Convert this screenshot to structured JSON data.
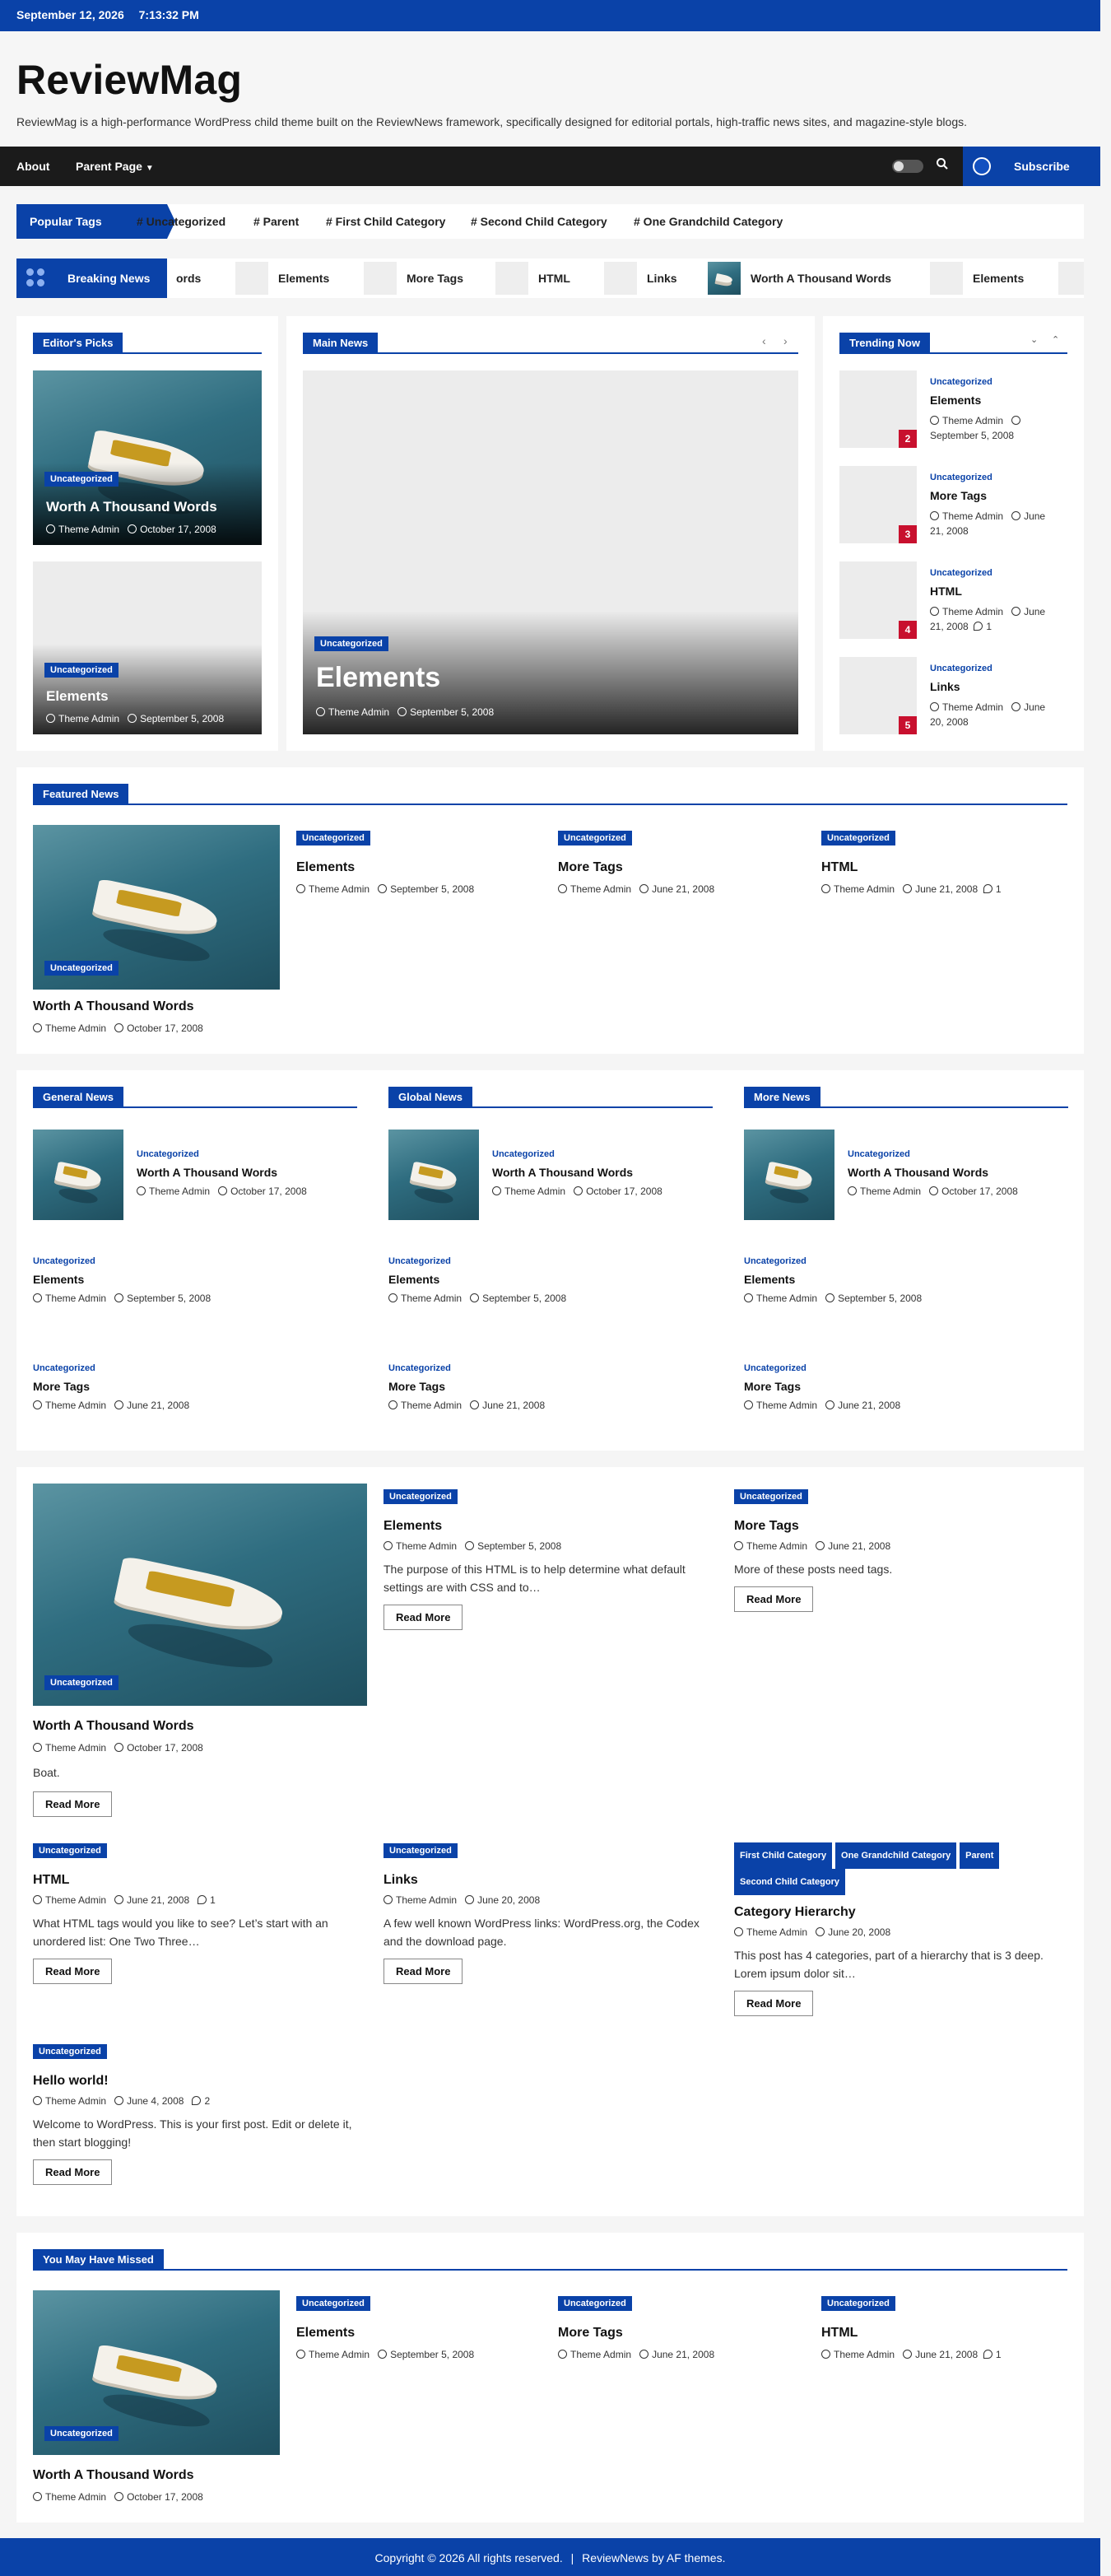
{
  "topbar": {
    "date": "September 12, 2026",
    "time": "7:13:32 PM"
  },
  "header": {
    "title": "ReviewMag",
    "tagline": "ReviewMag is a high-performance WordPress child theme built on the ReviewNews framework, specifically designed for editorial portals, high-traffic news sites, and magazine-style blogs."
  },
  "nav": {
    "about": "About",
    "parent": "Parent Page",
    "subscribe": "Subscribe"
  },
  "popular_tags": {
    "label": "Popular Tags",
    "tags": [
      "# Uncategorized",
      "# Parent",
      "# First Child Category",
      "# Second Child Category",
      "# One Grandchild Category"
    ]
  },
  "breaking": {
    "label": "Breaking News",
    "items": [
      "ords",
      "Elements",
      "More Tags",
      "HTML",
      "Links",
      "Worth A Thousand Words",
      "Elements"
    ]
  },
  "editors_picks": {
    "title": "Editor's Picks",
    "posts": [
      {
        "cat": "Uncategorized",
        "title": "Worth A Thousand Words",
        "author": "Theme Admin",
        "date": "October 17, 2008"
      },
      {
        "cat": "Uncategorized",
        "title": "Elements",
        "author": "Theme Admin",
        "date": "September 5, 2008"
      }
    ]
  },
  "main_news": {
    "title": "Main News",
    "post": {
      "cat": "Uncategorized",
      "title": "Elements",
      "author": "Theme Admin",
      "date": "September 5, 2008"
    }
  },
  "trending": {
    "title": "Trending Now",
    "posts": [
      {
        "num": "2",
        "cat": "Uncategorized",
        "title": "Elements",
        "author": "Theme Admin",
        "date": "September 5, 2008",
        "comments": ""
      },
      {
        "num": "3",
        "cat": "Uncategorized",
        "title": "More Tags",
        "author": "Theme Admin",
        "date": "June 21, 2008",
        "comments": ""
      },
      {
        "num": "4",
        "cat": "Uncategorized",
        "title": "HTML",
        "author": "Theme Admin",
        "date": "June 21, 2008",
        "comments": "1"
      },
      {
        "num": "5",
        "cat": "Uncategorized",
        "title": "Links",
        "author": "Theme Admin",
        "date": "June 20, 2008",
        "comments": ""
      }
    ]
  },
  "featured": {
    "title": "Featured News",
    "big": {
      "cat": "Uncategorized",
      "title": "Worth A Thousand Words",
      "author": "Theme Admin",
      "date": "October 17, 2008"
    },
    "posts": [
      {
        "cat": "Uncategorized",
        "title": "Elements",
        "author": "Theme Admin",
        "date": "September 5, 2008",
        "comments": ""
      },
      {
        "cat": "Uncategorized",
        "title": "More Tags",
        "author": "Theme Admin",
        "date": "June 21, 2008",
        "comments": ""
      },
      {
        "cat": "Uncategorized",
        "title": "HTML",
        "author": "Theme Admin",
        "date": "June 21, 2008",
        "comments": "1"
      }
    ]
  },
  "columns": [
    {
      "title": "General News",
      "posts": [
        {
          "cat": "Uncategorized",
          "title": "Worth A Thousand Words",
          "author": "Theme Admin",
          "date": "October 17, 2008"
        },
        {
          "cat": "Uncategorized",
          "title": "Elements",
          "author": "Theme Admin",
          "date": "September 5, 2008"
        },
        {
          "cat": "Uncategorized",
          "title": "More Tags",
          "author": "Theme Admin",
          "date": "June 21, 2008"
        }
      ]
    },
    {
      "title": "Global News",
      "posts": [
        {
          "cat": "Uncategorized",
          "title": "Worth A Thousand Words",
          "author": "Theme Admin",
          "date": "October 17, 2008"
        },
        {
          "cat": "Uncategorized",
          "title": "Elements",
          "author": "Theme Admin",
          "date": "September 5, 2008"
        },
        {
          "cat": "Uncategorized",
          "title": "More Tags",
          "author": "Theme Admin",
          "date": "June 21, 2008"
        }
      ]
    },
    {
      "title": "More News",
      "posts": [
        {
          "cat": "Uncategorized",
          "title": "Worth A Thousand Words",
          "author": "Theme Admin",
          "date": "October 17, 2008"
        },
        {
          "cat": "Uncategorized",
          "title": "Elements",
          "author": "Theme Admin",
          "date": "September 5, 2008"
        },
        {
          "cat": "Uncategorized",
          "title": "More Tags",
          "author": "Theme Admin",
          "date": "June 21, 2008"
        }
      ]
    }
  ],
  "grid": {
    "read_more": "Read More",
    "big": {
      "cat": "Uncategorized",
      "title": "Worth A Thousand Words",
      "author": "Theme Admin",
      "date": "October 17, 2008",
      "excerpt": "Boat."
    },
    "elements": {
      "cat": "Uncategorized",
      "title": "Elements",
      "author": "Theme Admin",
      "date": "September 5, 2008",
      "excerpt": "The purpose of this HTML is to help determine what default settings are with CSS and to…"
    },
    "moretags": {
      "cat": "Uncategorized",
      "title": "More Tags",
      "author": "Theme Admin",
      "date": "June 21, 2008",
      "excerpt": "More of these posts need tags."
    },
    "html": {
      "cat": "Uncategorized",
      "title": "HTML",
      "author": "Theme Admin",
      "date": "June 21, 2008",
      "comments": "1",
      "excerpt": "What HTML tags would you like to see? Let’s start with an unordered list: One Two Three…"
    },
    "links": {
      "cat": "Uncategorized",
      "title": "Links",
      "author": "Theme Admin",
      "date": "June 20, 2008",
      "excerpt": "A few well known WordPress links: WordPress.org, the Codex and the download page."
    },
    "hierarchy": {
      "cats": [
        "First Child Category",
        "One Grandchild Category",
        "Parent",
        "Second Child Category"
      ],
      "title": "Category Hierarchy",
      "author": "Theme Admin",
      "date": "June 20, 2008",
      "excerpt": "This post has 4 categories, part of a hierarchy that is 3 deep. Lorem ipsum dolor sit…"
    },
    "hello": {
      "cat": "Uncategorized",
      "title": "Hello world!",
      "author": "Theme Admin",
      "date": "June 4, 2008",
      "comments": "2",
      "excerpt": "Welcome to WordPress. This is your first post. Edit or delete it, then start blogging!"
    }
  },
  "missed": {
    "title": "You May Have Missed",
    "big": {
      "cat": "Uncategorized",
      "title": "Worth A Thousand Words",
      "author": "Theme Admin",
      "date": "October 17, 2008"
    },
    "posts": [
      {
        "cat": "Uncategorized",
        "title": "Elements",
        "author": "Theme Admin",
        "date": "September 5, 2008",
        "comments": ""
      },
      {
        "cat": "Uncategorized",
        "title": "More Tags",
        "author": "Theme Admin",
        "date": "June 21, 2008",
        "comments": ""
      },
      {
        "cat": "Uncategorized",
        "title": "HTML",
        "author": "Theme Admin",
        "date": "June 21, 2008",
        "comments": "1"
      }
    ]
  },
  "footer": {
    "copyright": "Copyright © 2026 All rights reserved.",
    "sep": "|",
    "credit": "ReviewNews by AF themes."
  },
  "colors": {
    "primary": "#0a42a8",
    "dark": "#1b1b1b",
    "trending_badge": "#c8102e"
  }
}
